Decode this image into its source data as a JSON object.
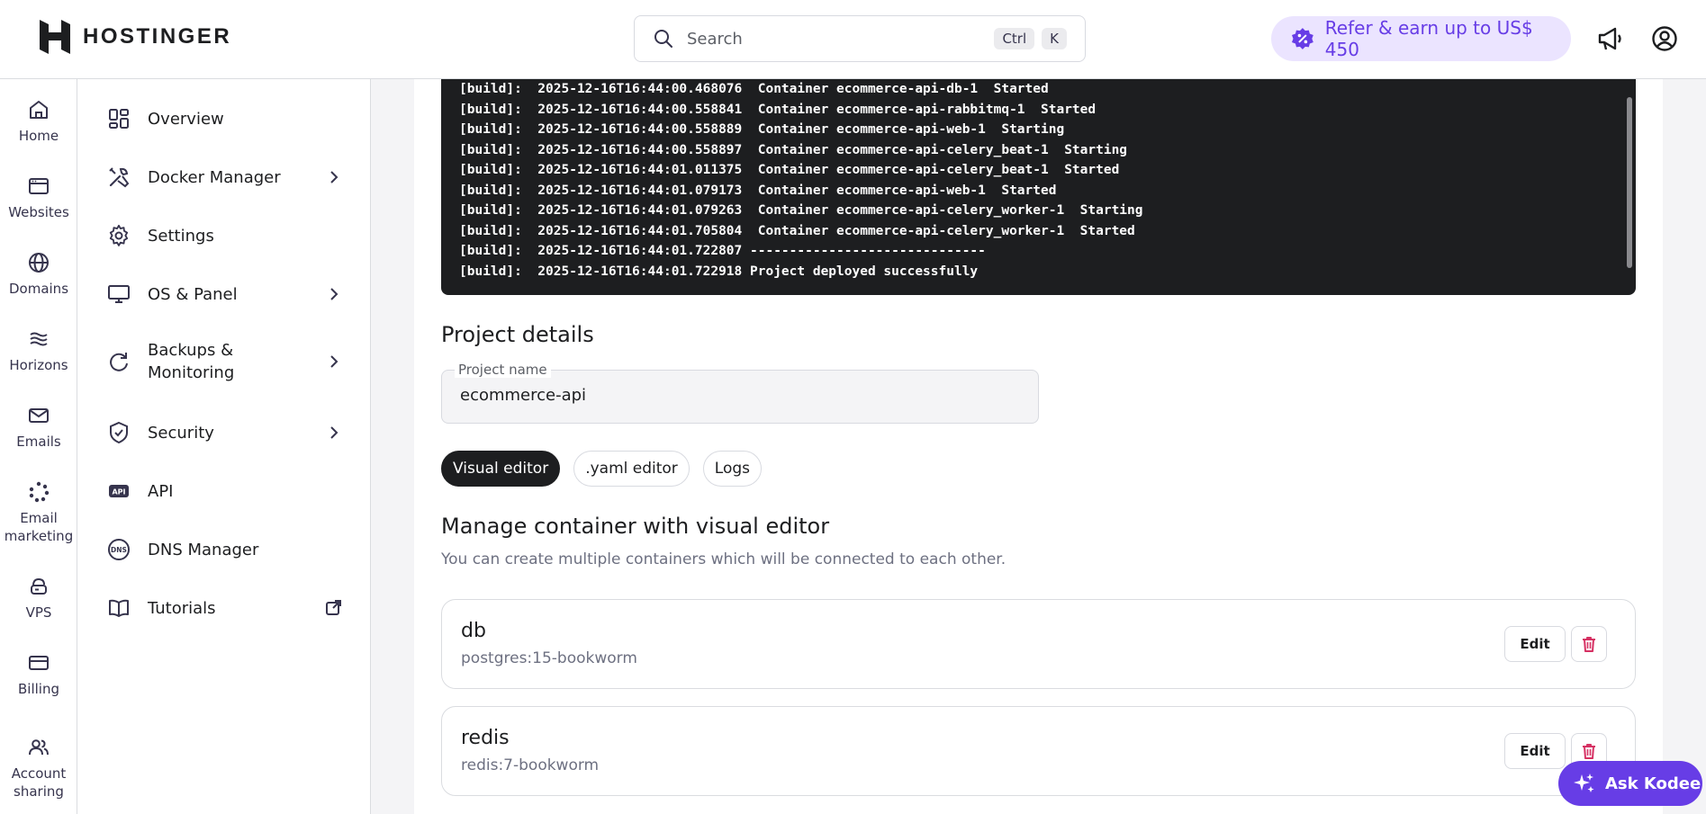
{
  "brand": {
    "name": "HOSTINGER"
  },
  "header": {
    "search_placeholder": "Search",
    "shortcut_ctrl": "Ctrl",
    "shortcut_key": "K",
    "refer_label": "Refer & earn up to US$ 450"
  },
  "rail": [
    {
      "label": "Home",
      "icon": "home-icon"
    },
    {
      "label": "Websites",
      "icon": "browser-icon"
    },
    {
      "label": "Domains",
      "icon": "globe-icon"
    },
    {
      "label": "Horizons",
      "icon": "horizons-icon"
    },
    {
      "label": "Emails",
      "icon": "mail-icon"
    },
    {
      "label": "Email marketing",
      "icon": "email-marketing-icon"
    },
    {
      "label": "VPS",
      "icon": "cloud-server-icon"
    },
    {
      "label": "Billing",
      "icon": "card-icon"
    },
    {
      "label": "Account sharing",
      "icon": "users-icon"
    }
  ],
  "subnav": [
    {
      "label": "Overview",
      "icon": "dashboard-icon"
    },
    {
      "label": "Docker Manager",
      "icon": "tools-icon"
    },
    {
      "label": "Settings",
      "icon": "gear-icon"
    },
    {
      "label": "OS & Panel",
      "icon": "monitor-icon"
    },
    {
      "label": "Backups & Monitoring",
      "icon": "refresh-icon"
    },
    {
      "label": "Security",
      "icon": "shield-icon"
    },
    {
      "label": "API",
      "icon": "api-icon"
    },
    {
      "label": "DNS Manager",
      "icon": "dns-icon"
    },
    {
      "label": "Tutorials",
      "icon": "book-icon"
    }
  ],
  "terminal": {
    "lines": [
      "[build]:  2025-12-16T16:44:00.468076  Container ecommerce-api-db-1  Started",
      "[build]:  2025-12-16T16:44:00.558841  Container ecommerce-api-rabbitmq-1  Started",
      "[build]:  2025-12-16T16:44:00.558889  Container ecommerce-api-web-1  Starting",
      "[build]:  2025-12-16T16:44:00.558897  Container ecommerce-api-celery_beat-1  Starting",
      "[build]:  2025-12-16T16:44:01.011375  Container ecommerce-api-celery_beat-1  Started",
      "[build]:  2025-12-16T16:44:01.079173  Container ecommerce-api-web-1  Started",
      "[build]:  2025-12-16T16:44:01.079263  Container ecommerce-api-celery_worker-1  Starting",
      "[build]:  2025-12-16T16:44:01.705804  Container ecommerce-api-celery_worker-1  Started",
      "[build]:  2025-12-16T16:44:01.722807 ------------------------------",
      "[build]:  2025-12-16T16:44:01.722918 Project deployed successfully"
    ]
  },
  "project": {
    "section_title": "Project details",
    "name_label": "Project name",
    "name_value": "ecommerce-api"
  },
  "tabs": [
    "Visual editor",
    ".yaml editor",
    "Logs"
  ],
  "editor": {
    "title": "Manage container with visual editor",
    "subtitle": "You can create multiple containers which will be connected to each other.",
    "edit_label": "Edit",
    "containers": [
      {
        "name": "db",
        "image": "postgres:15-bookworm"
      },
      {
        "name": "redis",
        "image": "redis:7-bookworm"
      }
    ]
  },
  "assistant": {
    "label": "Ask Kodee"
  },
  "colors": {
    "accent": "#673de6",
    "accent_light": "#ebe4ff",
    "danger": "#d63163",
    "terminal_bg": "#1d1e20"
  }
}
